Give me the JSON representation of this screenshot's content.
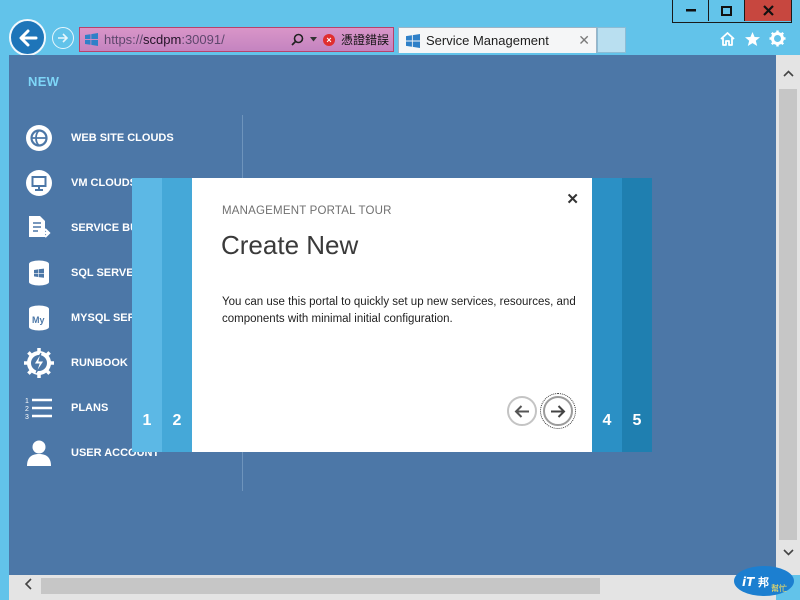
{
  "browser": {
    "address": {
      "url_prefix": "https://",
      "url_host": "scdpm",
      "url_suffix": ":30091/",
      "cert_error": "憑證錯誤"
    },
    "tab": {
      "title": "Service Management"
    },
    "window_buttons": [
      "minimize",
      "restore",
      "close"
    ],
    "toolbar_icons": [
      "home-icon",
      "favorites-icon",
      "settings-icon"
    ]
  },
  "sidebar": {
    "new_label": "NEW",
    "items": [
      {
        "label": "WEB SITE CLOUDS",
        "icon": "web-site-clouds-icon"
      },
      {
        "label": "VM CLOUDS",
        "icon": "vm-clouds-icon"
      },
      {
        "label": "SERVICE BUS",
        "icon": "service-bus-icon"
      },
      {
        "label": "SQL SERVER",
        "icon": "sql-server-icon"
      },
      {
        "label": "MYSQL SERVER",
        "icon": "mysql-server-icon"
      },
      {
        "label": "RUNBOOK",
        "icon": "runbook-icon"
      },
      {
        "label": "PLANS",
        "icon": "plans-icon"
      },
      {
        "label": "USER ACCOUNT",
        "icon": "user-account-icon"
      }
    ]
  },
  "tour": {
    "kicker": "MANAGEMENT PORTAL TOUR",
    "title": "Create New",
    "body": "You can use this portal to quickly set up new services, resources, and components with minimal initial configuration.",
    "steps_left": [
      "1",
      "2"
    ],
    "steps_right": [
      "4",
      "5"
    ]
  },
  "colors": {
    "portal_background": "#4c77a7",
    "accent_new": "#7ed6f8",
    "chrome": "#62c3ea",
    "address_bar_error": "#c484c0",
    "close_button": "#c7473f"
  },
  "watermark": {
    "text": "iT邦幫忙"
  }
}
